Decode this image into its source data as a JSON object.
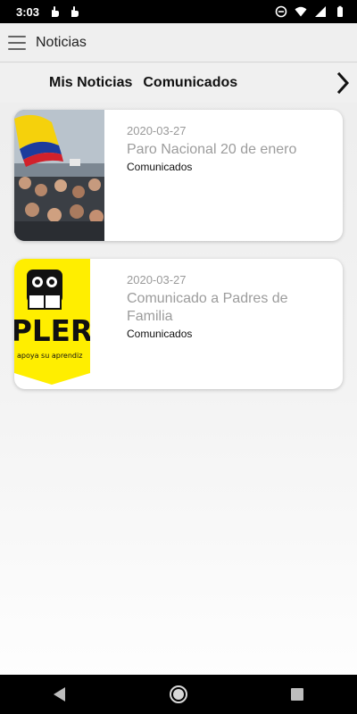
{
  "status_bar": {
    "time": "3:03",
    "notification_icons": [
      "hand-pointer-icon",
      "hand-pointer-icon"
    ],
    "system_icons": [
      "do-not-disturb-icon",
      "wifi-icon",
      "signal-icon",
      "battery-icon"
    ]
  },
  "app_bar": {
    "title": "Noticias",
    "menu_icon": "hamburger-menu-icon"
  },
  "tabs": {
    "items": [
      {
        "label": "Mis Noticias"
      },
      {
        "label": "Comunicados"
      }
    ],
    "next_icon": "chevron-right-icon"
  },
  "news": [
    {
      "date": "2020-03-27",
      "title": "Paro Nacional 20 de enero",
      "category": "Comunicados",
      "image": "protest-crowd-colombia-flag-photo"
    },
    {
      "date": "2020-03-27",
      "title": "Comunicado a Padres de Familia",
      "category": "Comunicados",
      "image": "pler-logo-yellow-banner",
      "image_text": {
        "brand": "PLER",
        "tagline": "apoya su aprendiz"
      }
    }
  ],
  "nav_bar": {
    "buttons": [
      "back-triangle-icon",
      "home-circle-icon",
      "recents-square-icon"
    ]
  },
  "colors": {
    "status_bar": "#000000",
    "app_bar": "#efefef",
    "date_text": "#9a9a9a",
    "title_text": "#9c9c9c",
    "pler_yellow": "#ffee00"
  }
}
